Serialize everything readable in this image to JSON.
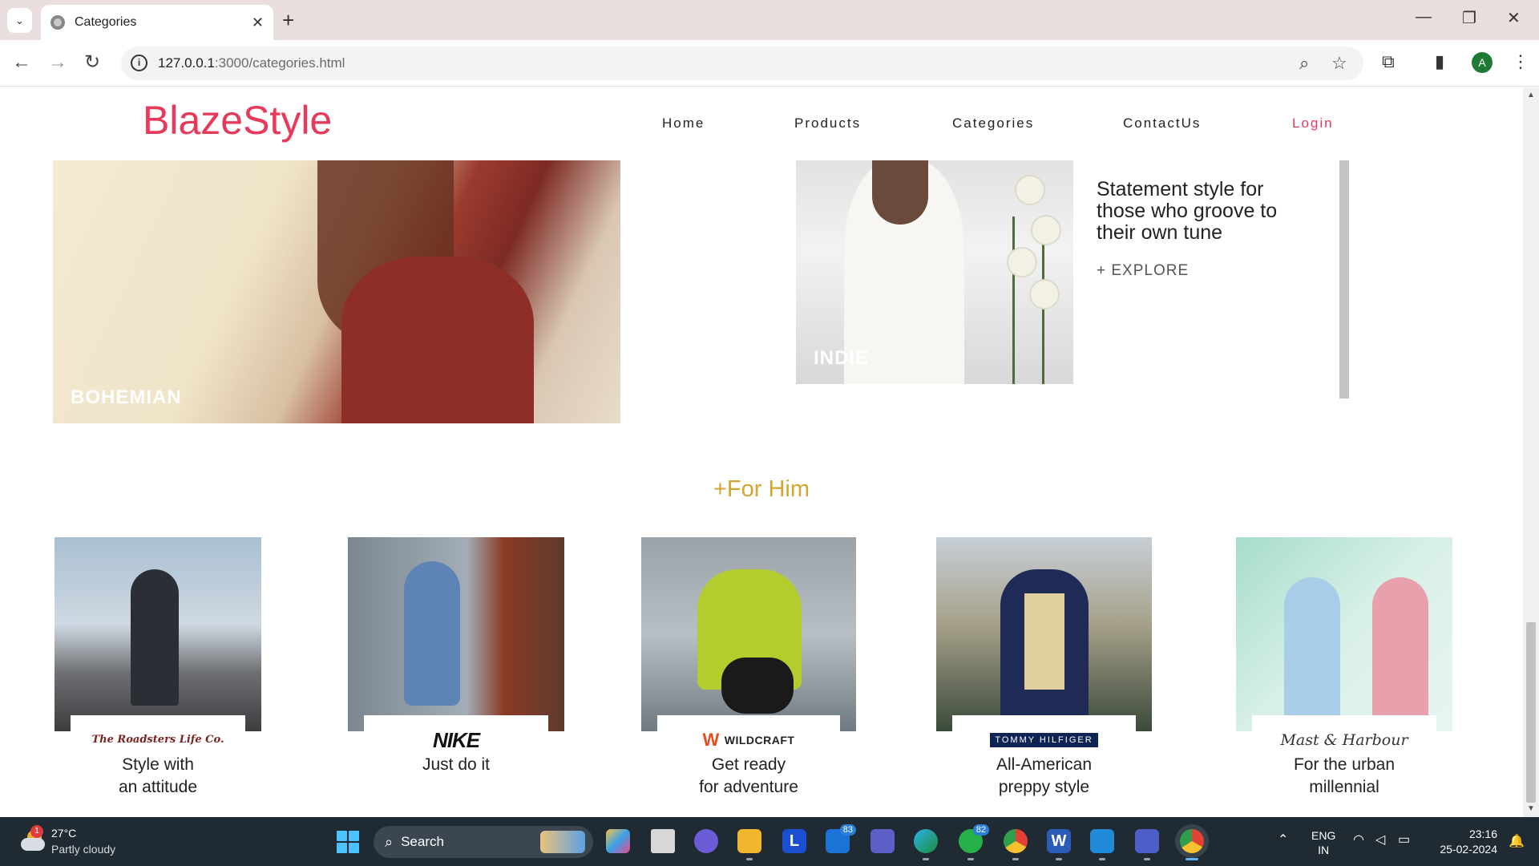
{
  "browser": {
    "tab_title": "Categories",
    "url_host": "127.0.0.1",
    "url_rest": ":3000/categories.html"
  },
  "site": {
    "logo": "BlazeStyle",
    "nav": [
      "Home",
      "Products",
      "Categories",
      "ContactUs",
      "Login"
    ],
    "accent_color": "#e73a5b",
    "gold_color": "#d4a531"
  },
  "styles": {
    "bohemian_label": "BOHEMIAN",
    "indie_label": "INDIE",
    "statement": "Statement style for those who groove to their own tune",
    "explore": "+ EXPLORE"
  },
  "for_him": {
    "heading": "+For Him",
    "cards": [
      {
        "brand": "The Roadsters Life Co.",
        "tagline_1": "Style with",
        "tagline_2": "an attitude"
      },
      {
        "brand": "NIKE",
        "tagline_1": "Just do it",
        "tagline_2": ""
      },
      {
        "brand": "WILDCRAFT",
        "tagline_1": "Get ready",
        "tagline_2": "for adventure"
      },
      {
        "brand": "TOMMY HILFIGER",
        "tagline_1": "All-American",
        "tagline_2": "preppy style"
      },
      {
        "brand": "Mast & Harbour",
        "tagline_1": "For the urban",
        "tagline_2": "millennial"
      }
    ]
  },
  "taskbar": {
    "weather_badge": "1",
    "temperature": "27°C",
    "weather": "Partly cloudy",
    "search": "Search",
    "mail_badge": "83",
    "whatsapp_badge": "82",
    "lang_1": "ENG",
    "lang_2": "IN",
    "time": "23:16",
    "date": "25-02-2024"
  }
}
